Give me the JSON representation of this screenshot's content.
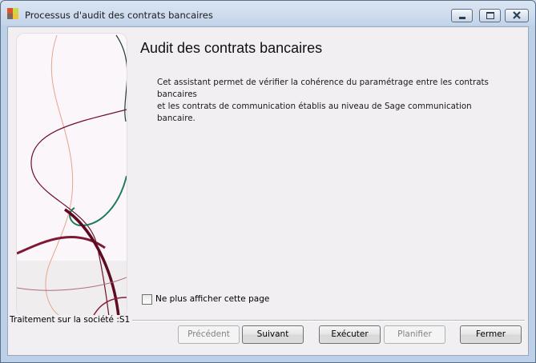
{
  "window": {
    "title": "Processus d'audit des contrats bancaires",
    "controls": [
      "minimize-icon",
      "maximize-icon",
      "close-icon"
    ]
  },
  "page": {
    "title": "Audit des contrats bancaires",
    "description_line1": "Cet assistant permet de vérifier la cohérence du paramétrage entre les contrats bancaires",
    "description_line2": "et les contrats de communication établis au niveau de Sage communication bancaire."
  },
  "options": {
    "skip_page_label": "Ne plus afficher cette page",
    "skip_page_checked": false
  },
  "status": {
    "company_label": "Traitement sur la société :S1"
  },
  "buttons": {
    "previous": "Précédent",
    "next": "Suivant",
    "execute": "Exécuter",
    "schedule": "Planifier",
    "close": "Fermer"
  },
  "colors": {
    "accent_burgundy": "#6e0f2a",
    "accent_green": "#1f7a5a",
    "title_bar": "#c4d5ea"
  }
}
